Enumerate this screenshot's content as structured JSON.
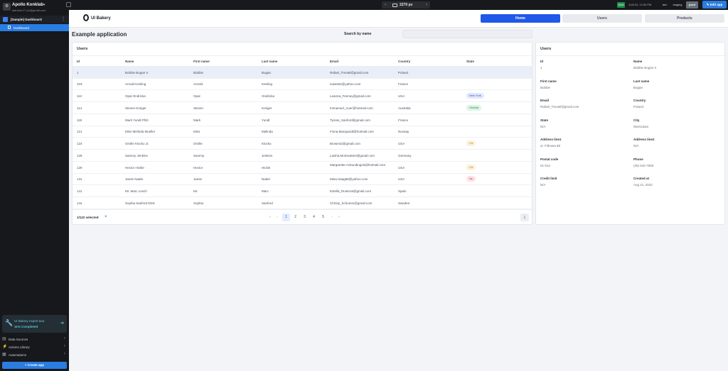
{
  "workspace": {
    "avatar_glyph": "⚙",
    "name": "Apollo Konklab",
    "email": "alarmist.27.po@gmail.com"
  },
  "sidebar": {
    "app_label": "[Sample] Dashboard",
    "page_label": "Dashboard",
    "expert_card": {
      "title": "UI Bakery expert tour",
      "progress": "11% Completed",
      "progress_value": 0.11
    },
    "links": [
      {
        "icon": "database-icon",
        "glyph": "▤",
        "label": "Data Sources"
      },
      {
        "icon": "actions-icon",
        "glyph": "⚡",
        "label": "Actions Library"
      },
      {
        "icon": "automations-icon",
        "glyph": "▦",
        "label": "Automations"
      }
    ],
    "create_label": "+ Create app"
  },
  "topbar": {
    "width_label": "2270 px",
    "version": "0.0.0",
    "date": "11/6/23, 12:06 PM",
    "environments": [
      {
        "label": "dev",
        "active": false
      },
      {
        "label": "staging",
        "active": false
      },
      {
        "label": "prod",
        "active": true
      }
    ],
    "edit_label": "✎ Edit app"
  },
  "app": {
    "logo_text": "UI Bakery",
    "nav": [
      {
        "label": "Home",
        "active": true
      },
      {
        "label": "Users",
        "active": false
      },
      {
        "label": "Products",
        "active": false
      }
    ],
    "page_title": "Example application",
    "search": {
      "label": "Search by name",
      "value": "",
      "placeholder": ""
    }
  },
  "table": {
    "title": "Users",
    "columns": [
      "Id",
      "Name",
      "First name",
      "Last name",
      "Email",
      "Country",
      "State"
    ],
    "rows": [
      {
        "id": "1",
        "name": "Bobbie Bogan II",
        "first": "Bobbie",
        "last": "Bogan",
        "email": "Rafael_Treutel@gmail.com",
        "country": "Poland",
        "state": "",
        "selected": true
      },
      {
        "id": "103",
        "name": "Arnold Keeling",
        "first": "Arnold",
        "last": "Keeling",
        "email": "Isaias52@yahoo.com",
        "country": "France",
        "state": ""
      },
      {
        "id": "112",
        "name": "Opal Ondricka",
        "first": "Opal",
        "last": "Ondricka",
        "email": "Leanna_Feeney@gmail.com",
        "country": "USA",
        "state": "New York",
        "state_color": "blue"
      },
      {
        "id": "114",
        "name": "Steven Kreiger",
        "first": "Steven",
        "last": "Kreiger",
        "email": "Immanuel_Auer@hotmail.com",
        "country": "Australia",
        "state": "Victoria",
        "state_color": "green"
      },
      {
        "id": "119",
        "name": "Mark Yundt PhD",
        "first": "Mark",
        "last": "Yundt",
        "email": "Tyrese_Sanford@gmail.com",
        "country": "France",
        "state": ""
      },
      {
        "id": "121",
        "name": "Miss Melinda Mueller",
        "first": "Miss",
        "last": "Melinda",
        "email": "Fiona.Marquardt@hotmail.com",
        "country": "Norway",
        "state": ""
      },
      {
        "id": "124",
        "name": "Orville Klocko Jr.",
        "first": "Orville",
        "last": "Klocko",
        "email": "Brown42@gmail.com",
        "country": "USA",
        "state": "Ca",
        "state_color": "orange"
      },
      {
        "id": "128",
        "name": "Sammy Jenkins",
        "first": "Sammy",
        "last": "Jenkins",
        "email": "Laisha.Morissette4@gmail.com",
        "country": "Germany",
        "state": ""
      },
      {
        "id": "129",
        "name": "Hector Hickle",
        "first": "Hector",
        "last": "Hickle",
        "email": "Margarette.Ankunding16@hotmail.com",
        "country": "USA",
        "state": "Ca",
        "state_color": "orange",
        "wrap": true
      },
      {
        "id": "131",
        "name": "Jamie Nader",
        "first": "Jamie",
        "last": "Nader",
        "email": "Mina.Haag68@yahoo.com",
        "country": "USA",
        "state": "Ny",
        "state_color": "red"
      },
      {
        "id": "141",
        "name": "Mr. Marc Lesch",
        "first": "Mr.",
        "last": "Marc",
        "email": "Estella_Runte16@gmail.com",
        "country": "Spain",
        "state": ""
      },
      {
        "id": "144",
        "name": "Sophia Sanford DDS",
        "first": "Sophia",
        "last": "Sanford",
        "email": "Christy_Schumm@gmail.com",
        "country": "Sweden",
        "state": ""
      }
    ],
    "selected_count": "1/122 selected",
    "clear_glyph": "×",
    "pager": {
      "first": "«",
      "prev": "‹",
      "pages": [
        "1",
        "2",
        "3",
        "4",
        "5"
      ],
      "current": "1",
      "next": "›",
      "last": "»"
    },
    "download_glyph": "⤓"
  },
  "details": {
    "title": "Users",
    "fields": [
      {
        "label": "Id",
        "value": "1"
      },
      {
        "label": "Name",
        "value": "Bobbie Bogan II"
      },
      {
        "label": "First name",
        "value": "Bobbie"
      },
      {
        "label": "Last name",
        "value": "Bogan"
      },
      {
        "label": "Email",
        "value": "Rafael_Treutel@gmail.com"
      },
      {
        "label": "Country",
        "value": "Poland"
      },
      {
        "label": "State",
        "value": "N/A"
      },
      {
        "label": "City",
        "value": "Warszawa"
      },
      {
        "label": "Address line1",
        "value": "ul. Filtrowa 68"
      },
      {
        "label": "Address line2",
        "value": "N/A"
      },
      {
        "label": "Postal code",
        "value": "01-012"
      },
      {
        "label": "Phone",
        "value": "(26) 642-7555"
      },
      {
        "label": "Credit limit",
        "value": "N/A"
      },
      {
        "label": "Created at",
        "value": "Aug 21, 2022"
      }
    ]
  },
  "colors": {
    "accent": "#2058e8",
    "sidebar_bg": "#17181b",
    "badge_blue": "#e1e8fd",
    "badge_green": "#ddf4e6",
    "badge_orange": "#fdf0d9",
    "badge_red": "#fde2e6"
  }
}
